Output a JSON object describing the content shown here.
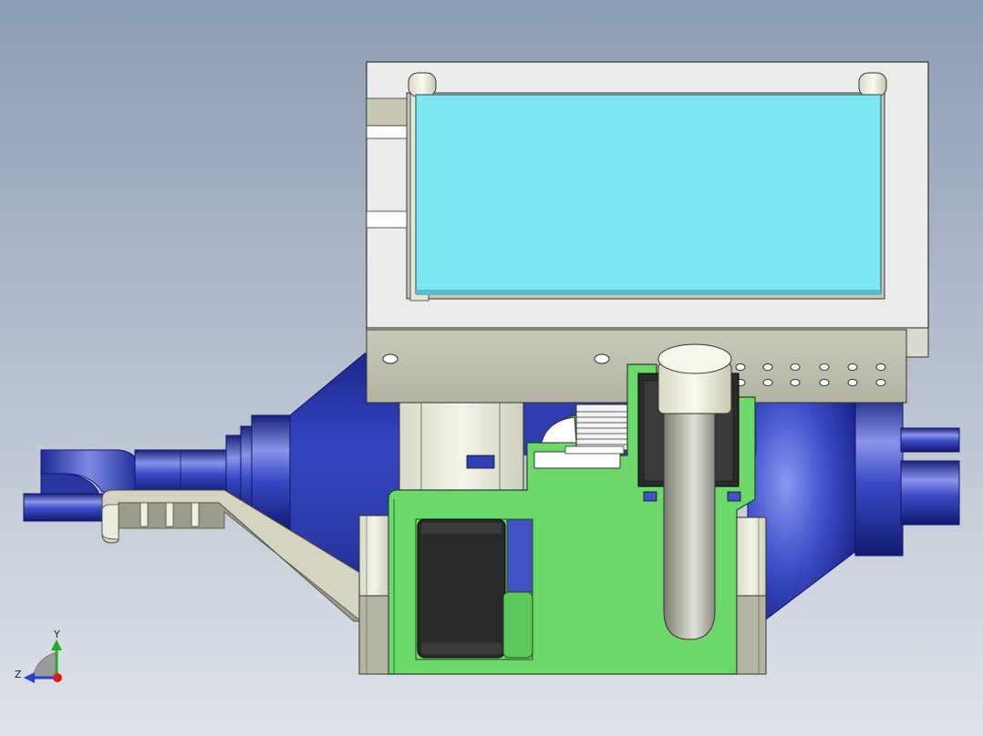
{
  "viewport": {
    "background_top": "#8d9db3",
    "background_bottom": "#dfe3ea"
  },
  "colors": {
    "blue_body": "#2f3fae",
    "blue_light": "#7d88e0",
    "blue_dark": "#141f7a",
    "green_board": "#6dd96b",
    "lcd_screen": "#7fe6f4",
    "frame_white": "#ececec",
    "frame_grey": "#bfbfac",
    "black_part": "#2a2a2a",
    "tube_grey": "#a3a39a"
  },
  "triad": {
    "y_label": "Y",
    "z_label": "Z",
    "y_color": "#1faa2a",
    "z_color": "#2a3fd0",
    "x_color": "#e01818"
  }
}
